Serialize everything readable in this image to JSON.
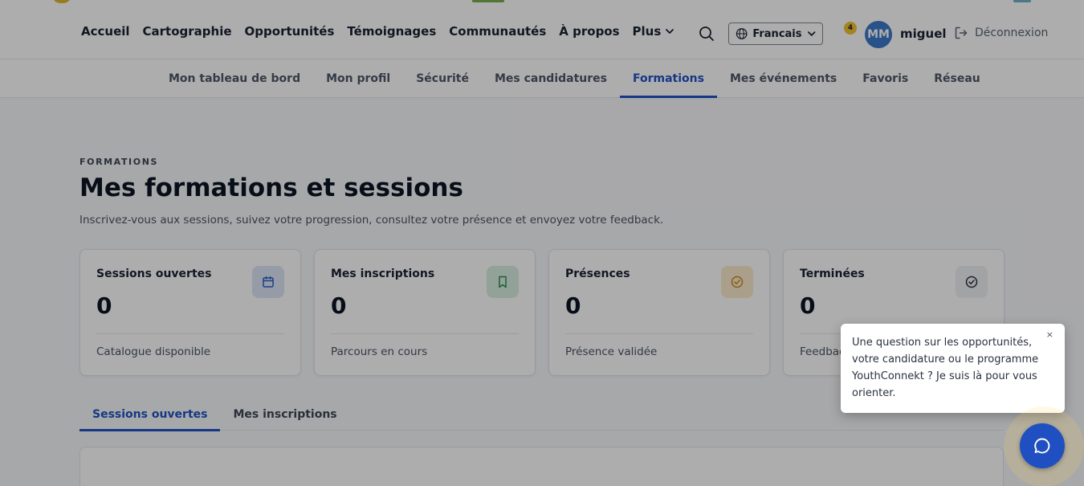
{
  "nav": {
    "items": [
      "Accueil",
      "Cartographie",
      "Opportunités",
      "Témoignages",
      "Communautés",
      "À propos"
    ],
    "more_label": "Plus"
  },
  "language": {
    "label": "Francais"
  },
  "user": {
    "notification_count": "4",
    "initials": "MM",
    "name": "miguel",
    "logout_label": "Déconnexion"
  },
  "subnav": {
    "items": [
      "Mon tableau de bord",
      "Mon profil",
      "Sécurité",
      "Mes candidatures",
      "Formations",
      "Mes événements",
      "Favoris",
      "Réseau"
    ],
    "active_index": 4
  },
  "header": {
    "eyebrow": "FORMATIONS",
    "title": "Mes formations et sessions",
    "description": "Inscrivez-vous aux sessions, suivez votre progression, consultez votre présence et envoyez votre feedback."
  },
  "stats": [
    {
      "title": "Sessions ouvertes",
      "value": "0",
      "subtitle": "Catalogue disponible",
      "icon": "calendar-icon",
      "icon_bg": "#dce6f7",
      "icon_color": "#2c5ec9"
    },
    {
      "title": "Mes inscriptions",
      "value": "0",
      "subtitle": "Parcours en cours",
      "icon": "bookmark-icon",
      "icon_bg": "#d9efe0",
      "icon_color": "#2f8a4f"
    },
    {
      "title": "Présences",
      "value": "0",
      "subtitle": "Présence validée",
      "icon": "check-circle-icon",
      "icon_bg": "#fbeacc",
      "icon_color": "#c98a1c"
    },
    {
      "title": "Terminées",
      "value": "0",
      "subtitle": "Feedback",
      "icon": "check-circle-icon",
      "icon_bg": "#eef0f3",
      "icon_color": "#2a3140"
    }
  ],
  "tabs": {
    "items": [
      "Sessions ouvertes",
      "Mes inscriptions"
    ],
    "active_index": 0
  },
  "chat": {
    "message": "Une question sur les opportunités, votre candidature ou le programme YouthConnekt ? Je suis là pour vous orienter.",
    "close_label": "×"
  },
  "colors": {
    "accent": "#1f52c4",
    "chat_button": "#1f4fc0",
    "badge": "#f2c230",
    "avatar": "#3b79c9"
  }
}
